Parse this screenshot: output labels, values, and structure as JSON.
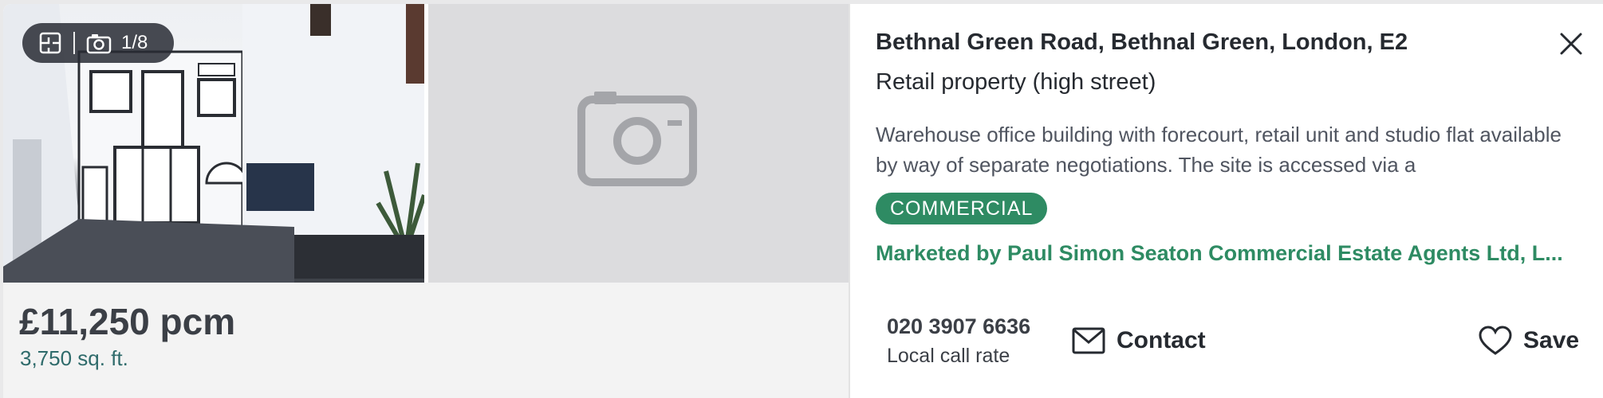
{
  "listing": {
    "photo_badge": {
      "counter": "1/8",
      "floorplan_icon": "floorplan-icon",
      "camera_icon": "camera-icon"
    },
    "price": "£11,250 pcm",
    "area": "3,750 sq. ft.",
    "address": "Bethnal Green Road, Bethnal Green, London, E2",
    "property_type": "Retail property (high street)",
    "description": "Warehouse office building with forecourt, retail unit and studio flat available by way of separate negotiations. The site is accessed via a",
    "tag": "COMMERCIAL",
    "marketed_by": "Marketed by Paul Simon Seaton Commercial Estate Agents Ltd, L...",
    "phone": "020 3907 6636",
    "call_rate": "Local call rate",
    "contact_label": "Contact",
    "save_label": "Save"
  },
  "colors": {
    "brand_green": "#2e8b63",
    "area_teal": "#2f6b6b",
    "text_dark": "#262a30",
    "placeholder_gray": "#dcdcde"
  }
}
